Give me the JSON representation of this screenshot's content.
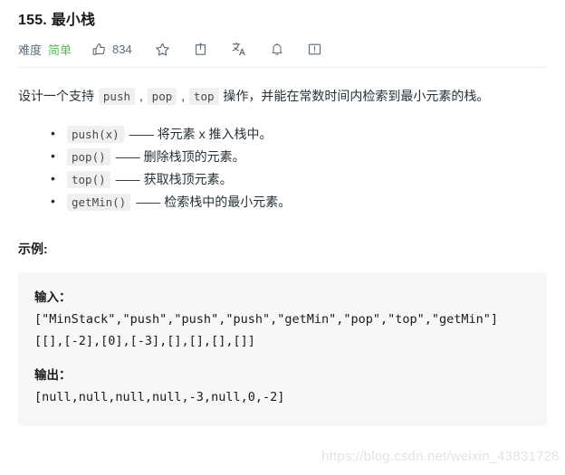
{
  "problem": {
    "title": "155. 最小栈",
    "difficulty_label": "难度",
    "difficulty_value": "简单",
    "like_count": "834"
  },
  "actions": [
    {
      "name": "thumbs-up-icon",
      "label": "834"
    },
    {
      "name": "star-icon",
      "label": ""
    },
    {
      "name": "share-icon",
      "label": ""
    },
    {
      "name": "translate-icon",
      "label": ""
    },
    {
      "name": "bell-icon",
      "label": ""
    },
    {
      "name": "report-icon",
      "label": ""
    }
  ],
  "description": {
    "part1": "设计一个支持 ",
    "code1": "push",
    "sep1": " , ",
    "code2": "pop",
    "sep2": " , ",
    "code3": "top",
    "part2": " 操作，并能在常数时间内检索到最小元素的栈。"
  },
  "operations": [
    {
      "code": "push(x)",
      "dash": "——",
      "text": "将元素 x 推入栈中。"
    },
    {
      "code": "pop()",
      "dash": "——",
      "text": "删除栈顶的元素。"
    },
    {
      "code": "top()",
      "dash": "——",
      "text": "获取栈顶元素。"
    },
    {
      "code": "getMin()",
      "dash": "——",
      "text": "检索栈中的最小元素。"
    }
  ],
  "example": {
    "heading": "示例:",
    "input_label": "输入：",
    "input_lines": [
      "[\"MinStack\",\"push\",\"push\",\"push\",\"getMin\",\"pop\",\"top\",\"getMin\"]",
      "[[],[-2],[0],[-3],[],[],[],[]]"
    ],
    "output_label": "输出：",
    "output_lines": [
      "[null,null,null,null,-3,null,0,-2]"
    ]
  },
  "watermark": "https://blog.csdn.net/weixin_43831728",
  "colors": {
    "difficulty_green": "#5cb85c",
    "text": "#263238",
    "muted": "#5c6b77",
    "code_bg": "#f7f7f7",
    "inline_code_bg": "#f0f0f0",
    "divider": "#eceef0",
    "watermark": "#e3e3e3"
  }
}
